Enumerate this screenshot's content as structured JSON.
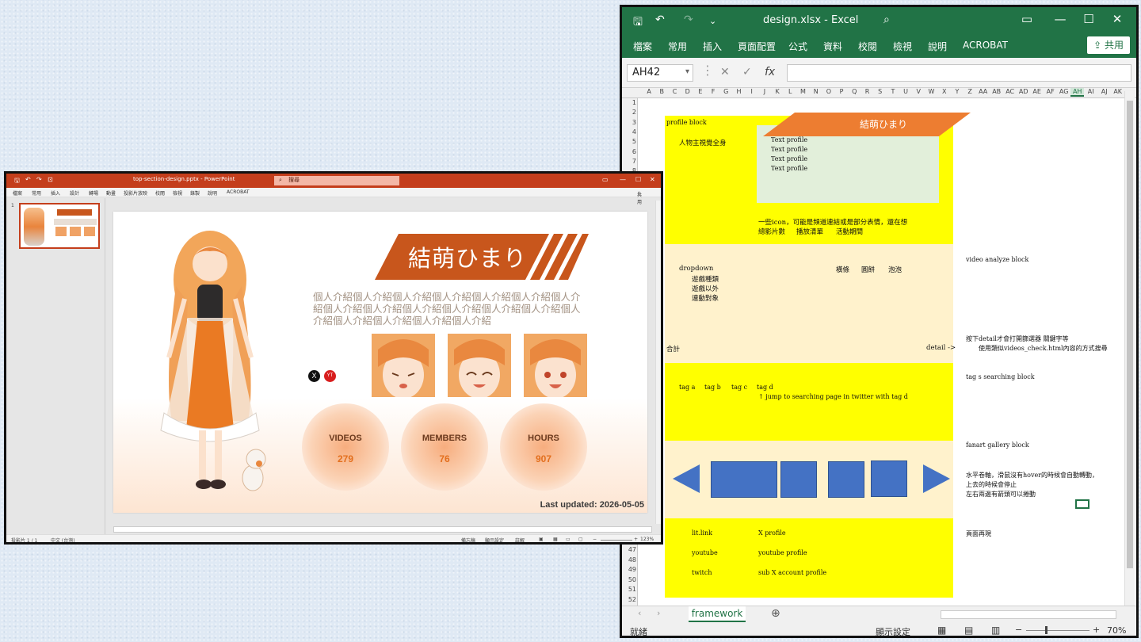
{
  "excel": {
    "title": "design.xlsx - Excel",
    "tabs": [
      "檔案",
      "常用",
      "插入",
      "頁面配置",
      "公式",
      "資料",
      "校閱",
      "檢視",
      "說明",
      "ACROBAT"
    ],
    "share": "共用",
    "name_box": "AH42",
    "columns": [
      "A",
      "B",
      "C",
      "D",
      "E",
      "F",
      "G",
      "H",
      "I",
      "J",
      "K",
      "L",
      "M",
      "N",
      "O",
      "P",
      "Q",
      "R",
      "S",
      "T",
      "U",
      "V",
      "W",
      "X",
      "Y",
      "Z",
      "AA",
      "AB",
      "AC",
      "AD",
      "AE",
      "AF",
      "AG",
      "AH",
      "AI",
      "AJ",
      "AK"
    ],
    "rows_top": [
      "1",
      "2",
      "3",
      "4",
      "5",
      "6",
      "7",
      "8",
      "9"
    ],
    "rows_bottom": [
      "47",
      "48",
      "49",
      "50",
      "51",
      "52"
    ],
    "profile": {
      "block": "profile block",
      "name": "結萌ひまり",
      "visual": "人物主視覺全身",
      "text_profile": [
        "Text profile",
        "Text profile",
        "Text profile",
        "Text profile"
      ],
      "note_line1": "一些icon，可能是頻道連結或是部分表情，還在想",
      "note_line2_a": "總影片數",
      "note_line2_b": "播放清單",
      "note_line2_c": "活動期間"
    },
    "video": {
      "dropdown": "dropdown",
      "items": [
        "遊戲種類",
        "遊戲以外",
        "連動對象"
      ],
      "views": [
        "橫條",
        "圓餅",
        "泡泡"
      ],
      "total": "合計",
      "detail": "detail ->",
      "block": "video analyze block",
      "note1": "按下detail才會打開篩選器 關鍵字等",
      "note2": "使用類似videos_check.html內容的方式搜尋"
    },
    "tags": {
      "items": [
        "tag a",
        "tag b",
        "tag c",
        "tag d"
      ],
      "jump": "↑ jump to searching page in twitter with tag d",
      "block": "tag s searching block"
    },
    "gallery": {
      "block": "fanart gallery block",
      "note1": "水平卷軸，滑鼠沒有hover的時候會自動轉動，",
      "note2": "上去的時候會停止",
      "note3": "左右兩邊有箭頭可以捲動"
    },
    "links": {
      "rows": [
        [
          "lit.link",
          "X profile"
        ],
        [
          "youtube",
          "youtube profile"
        ],
        [
          "twitch",
          "sub X account profile"
        ]
      ],
      "note": "頁面再現"
    },
    "sheet_tab": "framework",
    "status": "就緒",
    "display_settings": "顯示設定",
    "zoom": "70%"
  },
  "ppt": {
    "title": "top-section-design.pptx - PowerPoint",
    "search": "搜尋",
    "tabs": [
      "檔案",
      "常用",
      "插入",
      "設計",
      "轉場",
      "動畫",
      "投影片放映",
      "校閱",
      "檢視",
      "錄製",
      "說明",
      "ACROBAT"
    ],
    "share": "共用",
    "slide_number": "1",
    "slide": {
      "name": "結萌ひまり",
      "intro": "個人介紹個人介紹個人介紹個人介紹個人介紹個人介紹個人介紹個人介紹個人介紹個人介紹個人介紹個人介紹個人介紹個人介紹個人介紹個人介紹個人介紹個人介紹",
      "icons": [
        "X",
        "YT"
      ],
      "stats": [
        {
          "label": "VIDEOS",
          "value": "279"
        },
        {
          "label": "MEMBERS",
          "value": "76"
        },
        {
          "label": "HOURS",
          "value": "907"
        }
      ],
      "updated": "Last updated: 2026-05-05"
    },
    "status": {
      "slide_count": "投影片 1 / 1",
      "language": "中文 (台灣)",
      "notes": "備忘稿",
      "display": "顯示設定",
      "comments": "註解",
      "zoom": "123%"
    },
    "colors": {
      "accent": "#c8561c",
      "brand_orange": "#e36f1e"
    }
  }
}
